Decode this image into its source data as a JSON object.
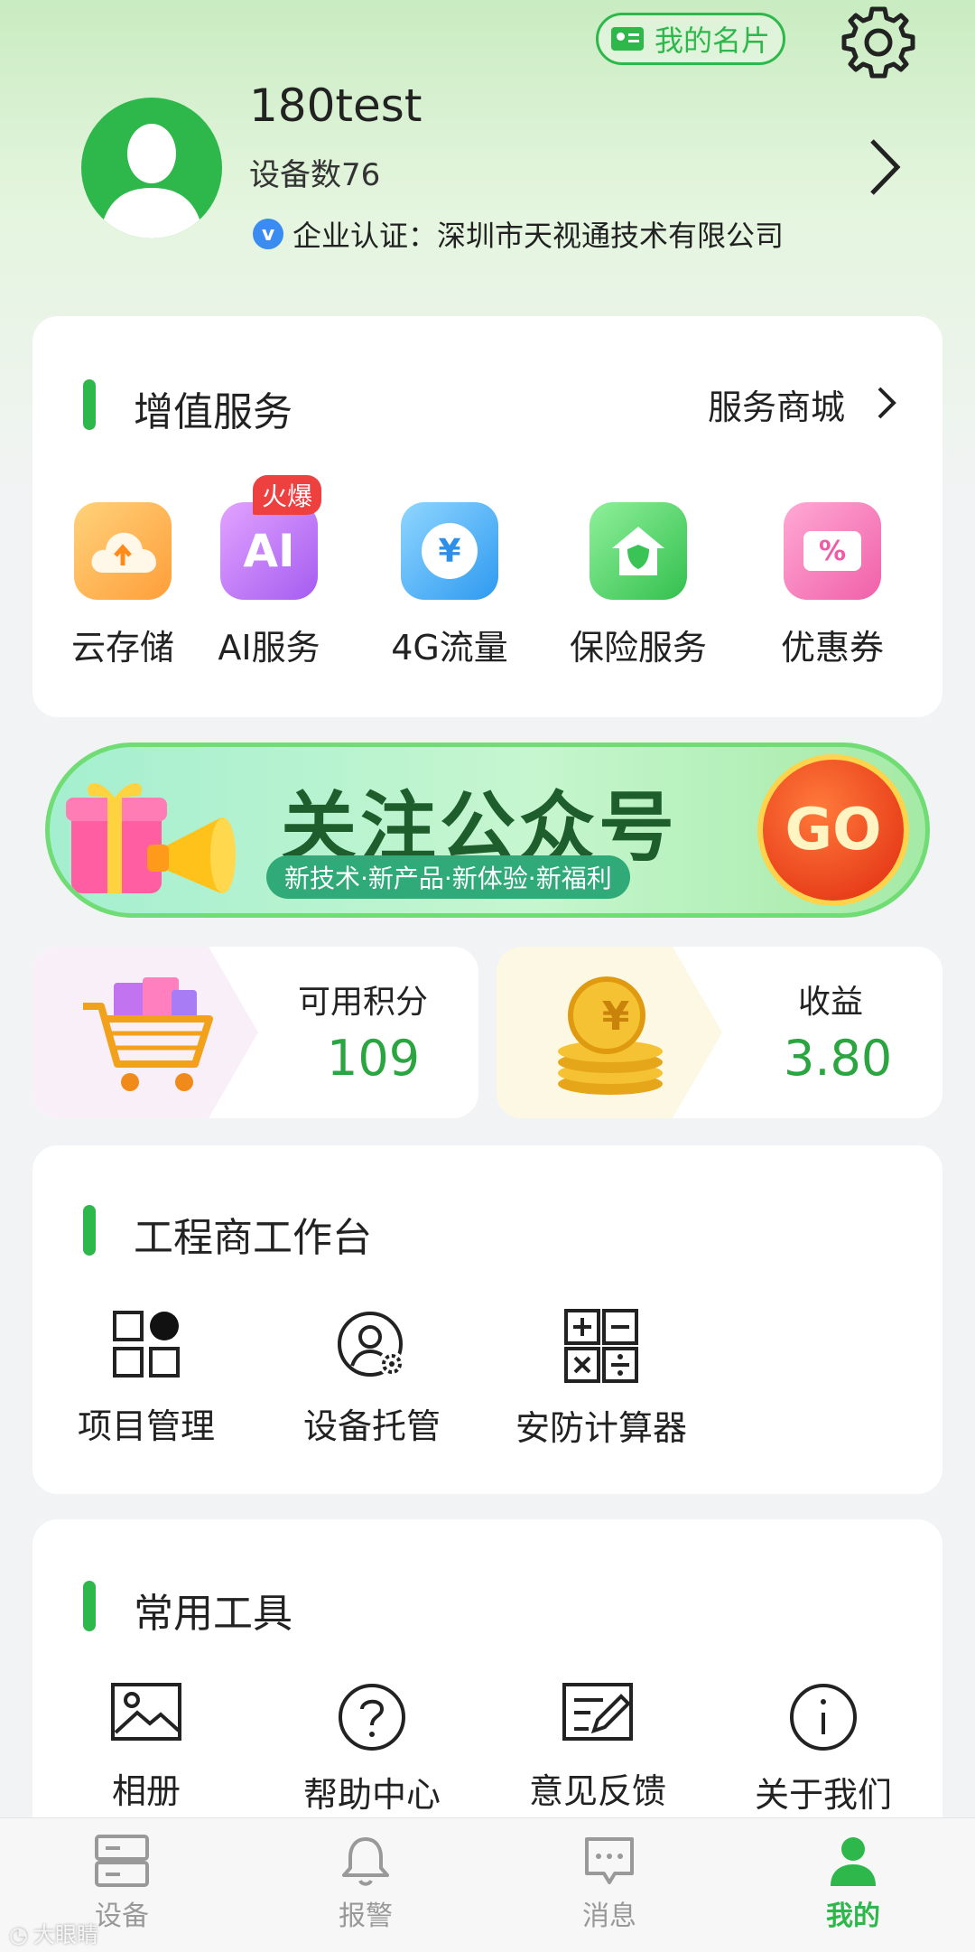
{
  "header": {
    "card_button_label": "我的名片",
    "username": "180test",
    "device_count": "设备数76",
    "certification": "企业认证：深圳市天视通技术有限公司"
  },
  "value_services": {
    "title": "增值服务",
    "link_label": "服务商城",
    "hot_badge": "火爆",
    "items": [
      {
        "label": "云存储",
        "icon": "cloud-upload-icon"
      },
      {
        "label": "AI服务",
        "icon": "ai-icon",
        "glyph": "AI"
      },
      {
        "label": "4G流量",
        "icon": "yen-coin-icon",
        "glyph": "¥"
      },
      {
        "label": "保险服务",
        "icon": "shield-house-icon"
      },
      {
        "label": "优惠券",
        "icon": "coupon-icon",
        "glyph": "%"
      }
    ]
  },
  "banner": {
    "title": "关注公众号",
    "subtitle": "新技术·新产品·新体验·新福利",
    "go_label": "GO"
  },
  "points": {
    "label": "可用积分",
    "value": "109"
  },
  "earnings": {
    "label": "收益",
    "value": "3.80",
    "glyph": "¥"
  },
  "workbench": {
    "title": "工程商工作台",
    "items": [
      {
        "label": "项目管理",
        "icon": "project-grid-icon"
      },
      {
        "label": "设备托管",
        "icon": "user-gear-icon"
      },
      {
        "label": "安防计算器",
        "icon": "calculator-icon"
      }
    ]
  },
  "tools": {
    "title": "常用工具",
    "items": [
      {
        "label": "相册",
        "icon": "image-icon"
      },
      {
        "label": "帮助中心",
        "icon": "help-icon"
      },
      {
        "label": "意见反馈",
        "icon": "feedback-icon"
      },
      {
        "label": "关于我们",
        "icon": "info-icon"
      }
    ]
  },
  "tabs": [
    {
      "label": "设备",
      "icon": "device-icon",
      "active": false
    },
    {
      "label": "报警",
      "icon": "bell-icon",
      "active": false
    },
    {
      "label": "消息",
      "icon": "message-icon",
      "active": false
    },
    {
      "label": "我的",
      "icon": "user-icon",
      "active": true
    }
  ],
  "watermark": "大眼睛",
  "colors": {
    "accent_green": "#2eb84b",
    "value_green": "#2aa53f",
    "hot_red": "#ef4040",
    "text_dark": "#222222",
    "text_gray": "#8a8a8a"
  }
}
